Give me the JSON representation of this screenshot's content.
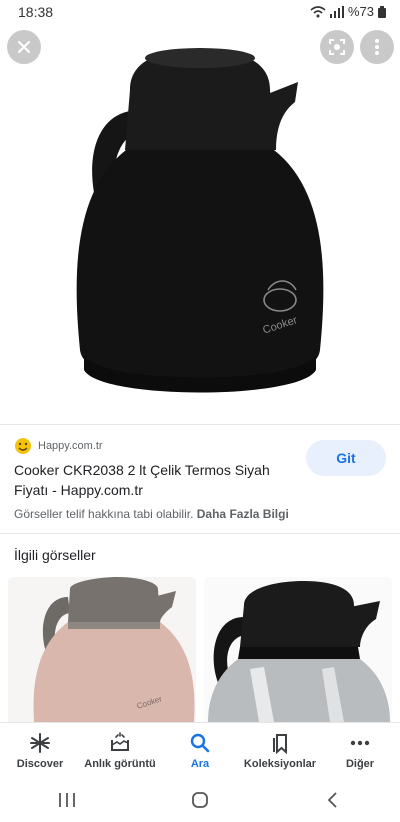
{
  "status": {
    "time": "18:38",
    "battery": "%73"
  },
  "hero": {
    "close_icon": "close-icon",
    "lens_icon": "lens-icon",
    "more_icon": "more-vert-icon",
    "logo_text": "Cooker"
  },
  "result": {
    "source": "Happy.com.tr",
    "title": "Cooker CKR2038 2 lt Çelik Termos Siyah Fiyatı - Happy.com.tr",
    "go_label": "Git",
    "copyright": "Görseller telif hakkına tabi olabilir.",
    "more_info": "Daha Fazla Bilgi"
  },
  "related": {
    "title": "İlgili görseller"
  },
  "bottom_nav": [
    {
      "label": "Discover",
      "icon": "asterisk-icon"
    },
    {
      "label": "Anlık görüntü",
      "icon": "snapshot-icon"
    },
    {
      "label": "Ara",
      "icon": "search-icon"
    },
    {
      "label": "Koleksiyonlar",
      "icon": "bookmark-icon"
    },
    {
      "label": "Diğer",
      "icon": "more-horiz-icon"
    }
  ],
  "colors": {
    "accent": "#1a73e8",
    "go_bg": "#e8f0fe"
  }
}
